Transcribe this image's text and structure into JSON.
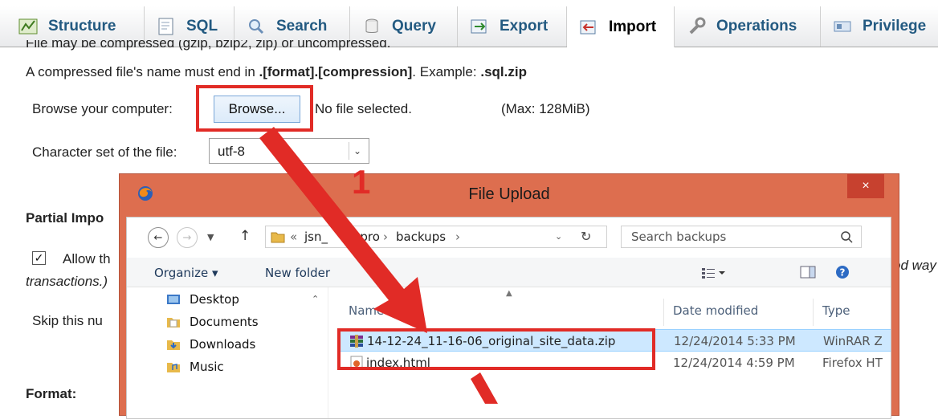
{
  "tabs": [
    {
      "label": "Structure",
      "icon": "structure-icon"
    },
    {
      "label": "SQL",
      "icon": "sql-icon"
    },
    {
      "label": "Search",
      "icon": "search-icon"
    },
    {
      "label": "Query",
      "icon": "query-icon"
    },
    {
      "label": "Export",
      "icon": "export-icon"
    },
    {
      "label": "Import",
      "icon": "import-icon",
      "active": true
    },
    {
      "label": "Operations",
      "icon": "wrench-icon"
    },
    {
      "label": "Privilege",
      "icon": "privileges-icon"
    }
  ],
  "import_page": {
    "compression_note": "File may be compressed (gzip, bzip2, zip) or uncompressed.",
    "name_note_prefix": "A compressed file's name must end in ",
    "name_note_format": ".[format].[compression]",
    "name_note_middle": ". Example: ",
    "name_note_example": ".sql.zip",
    "browse_label": "Browse your computer:",
    "browse_button": "Browse...",
    "no_file_text": "No file selected.",
    "max_size": "(Max: 128MiB)",
    "charset_label": "Character set of the file:",
    "charset_value": "utf-8",
    "partial_heading": "Partial Impo",
    "allow_text": "Allow th",
    "allow_tail": "od way",
    "transactions_text": "transactions.)",
    "skip_text": "Skip this nu",
    "format_heading": "Format:"
  },
  "dialog": {
    "title": "File Upload",
    "close_label": "×",
    "path": [
      "jsn_",
      "t_pro",
      "backups"
    ],
    "path_separator": "›",
    "path_prefix": "«",
    "search_placeholder": "Search backups",
    "organize_label": "Organize ▾",
    "new_folder_label": "New folder",
    "nav_items": [
      "Desktop",
      "Documents",
      "Downloads",
      "Music"
    ],
    "columns": {
      "name": "Name",
      "date": "Date modified",
      "type": "Type"
    },
    "files": [
      {
        "name": "14-12-24_11-16-06_original_site_data.zip",
        "date": "12/24/2014 5:33 PM",
        "type": "WinRAR Z",
        "icon": "winrar-archive-icon",
        "selected": true
      },
      {
        "name": "index.html",
        "date": "12/24/2014 4:59 PM",
        "type": "Firefox HT",
        "icon": "firefox-html-icon",
        "selected": false
      }
    ]
  },
  "annotation": {
    "step_number": "1"
  },
  "colors": {
    "accent_red": "#e12b26",
    "dialog_frame": "#dd6e4f",
    "tab_text": "#235a81",
    "selection": "#cde8ff"
  }
}
